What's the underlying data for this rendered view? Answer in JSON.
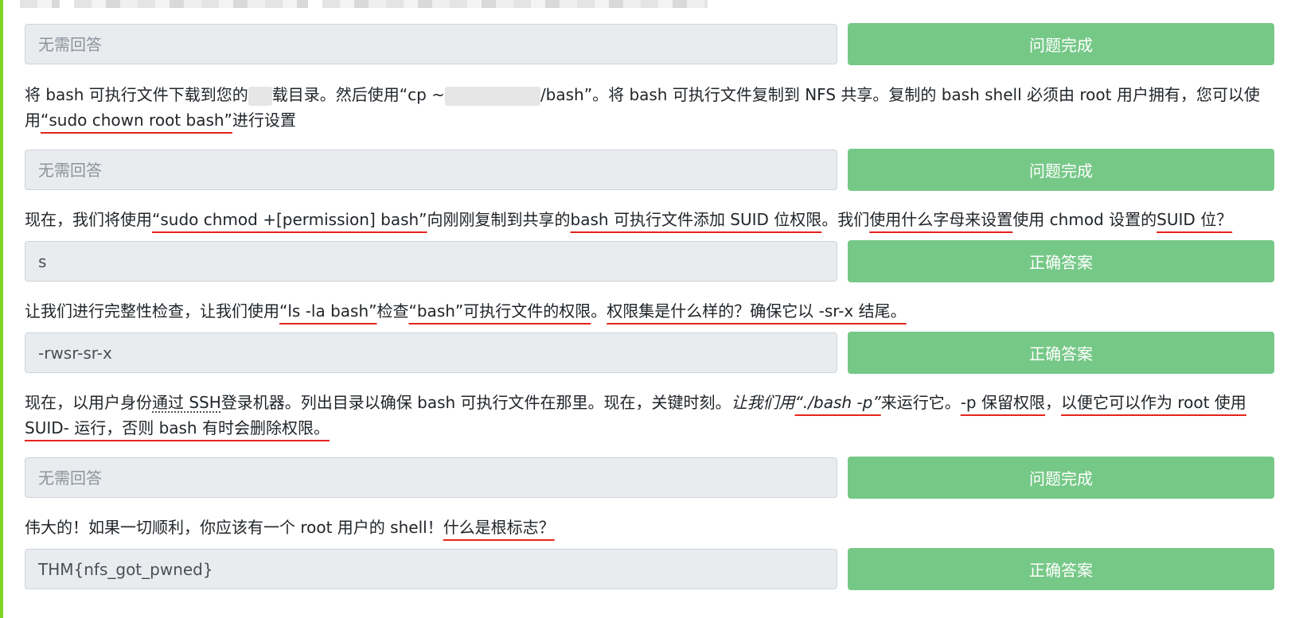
{
  "answers": [
    {
      "placeholder": "无需回答",
      "value": "",
      "button": "问题完成"
    },
    {
      "placeholder": "无需回答",
      "value": "",
      "button": "问题完成"
    },
    {
      "placeholder": "",
      "value": "s",
      "button": "正确答案"
    },
    {
      "placeholder": "",
      "value": "-rwsr-sr-x",
      "button": "正确答案"
    },
    {
      "placeholder": "无需回答",
      "value": "",
      "button": "问题完成"
    },
    {
      "placeholder": "",
      "value": "THM{nfs_got_pwned}",
      "button": "正确答案"
    }
  ],
  "questions": {
    "q2": {
      "p1": "将 bash 可执行文件下载到您的",
      "p2": "载目录。然后使用“cp ~",
      "p3": "/bash”。将 bash 可执行文件复制到 NFS 共享。复制的 bash shell 必须由 root 用户拥有，您可以使用",
      "p4": "“sudo chown root bash”",
      "p5": "进行设置"
    },
    "q3": {
      "p1": "现在，我们将使用",
      "p2": "“sudo chmod +[permission] bash”",
      "p3": "向刚刚复制到共享的",
      "p4": "bash 可执行文件",
      "p5": "添加 SUID 位权限",
      "p6": "。我们",
      "p7": "使用什么字母来设置",
      "p8": "使用 chmod 设置的",
      "p9": "SUID 位？"
    },
    "q4": {
      "p1": "让我们进行完整性检查，让我们使用",
      "p2": "“ls -la bash”",
      "p3": "检查",
      "p4": "“bash”可执行文件的权限",
      "p5": "。",
      "p6": "权限集是什么样的？确保它以 -sr-x 结尾。"
    },
    "q5": {
      "p1": "现在，以用户身份",
      "p2": "通过 SSH",
      "p3": "登录机器。列出目录以确保 bash 可执行文件在那里。现在，关键时刻。",
      "p4": "让我们用",
      "p5": "“./bash -p”",
      "p6": "来运行它。",
      "p7": "-p 保留权限",
      "p8": "，",
      "p9": "以便它可以作为 root 使用 SUID- 运行，否则 bash 有时会删除权限。"
    },
    "q6": {
      "p1": "伟大的！如果一切顺利，你应该有一个 root 用户的 shell！",
      "p2": "什么是根标志？"
    }
  }
}
